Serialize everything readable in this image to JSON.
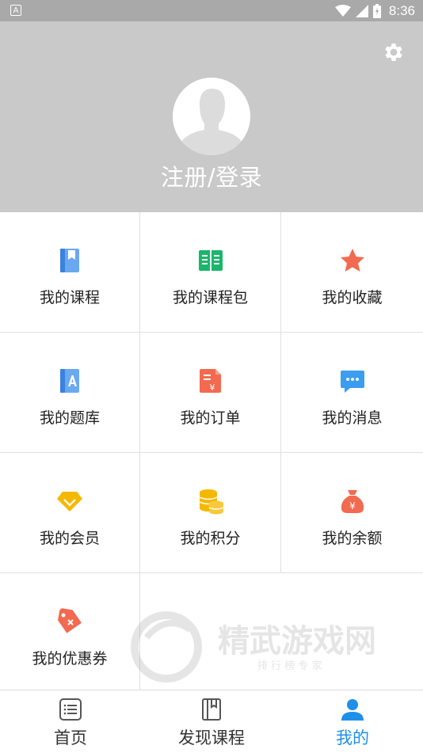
{
  "status_bar": {
    "time": "8:36",
    "left_icon": "A"
  },
  "header": {
    "login_label": "注册/登录",
    "settings_icon": "gear-icon",
    "avatar_icon": "user-avatar-icon"
  },
  "grid": {
    "items": [
      {
        "label": "我的课程",
        "icon": "book-icon",
        "color": "#4a90e8"
      },
      {
        "label": "我的课程包",
        "icon": "open-book-icon",
        "color": "#1ab66b"
      },
      {
        "label": "我的收藏",
        "icon": "star-icon",
        "color": "#f26a4f"
      },
      {
        "label": "我的题库",
        "icon": "question-bank-icon",
        "color": "#4a90e8"
      },
      {
        "label": "我的订单",
        "icon": "order-icon",
        "color": "#f26a4f"
      },
      {
        "label": "我的消息",
        "icon": "message-icon",
        "color": "#3a9df0"
      },
      {
        "label": "我的会员",
        "icon": "vip-diamond-icon",
        "color": "#f5b800"
      },
      {
        "label": "我的积分",
        "icon": "coins-icon",
        "color": "#f5b800"
      },
      {
        "label": "我的余额",
        "icon": "money-bag-icon",
        "color": "#f26a4f"
      },
      {
        "label": "我的优惠券",
        "icon": "coupon-icon",
        "color": "#f26a4f"
      }
    ]
  },
  "tabbar": {
    "tabs": [
      {
        "label": "首页",
        "icon": "list-icon",
        "active": false
      },
      {
        "label": "发现课程",
        "icon": "bookmark-book-icon",
        "active": false
      },
      {
        "label": "我的",
        "icon": "person-icon",
        "active": true
      }
    ],
    "active_color": "#1e90e8"
  },
  "watermark": {
    "title": "精武游戏网",
    "subtitle": "排 行 榜 专 家"
  }
}
